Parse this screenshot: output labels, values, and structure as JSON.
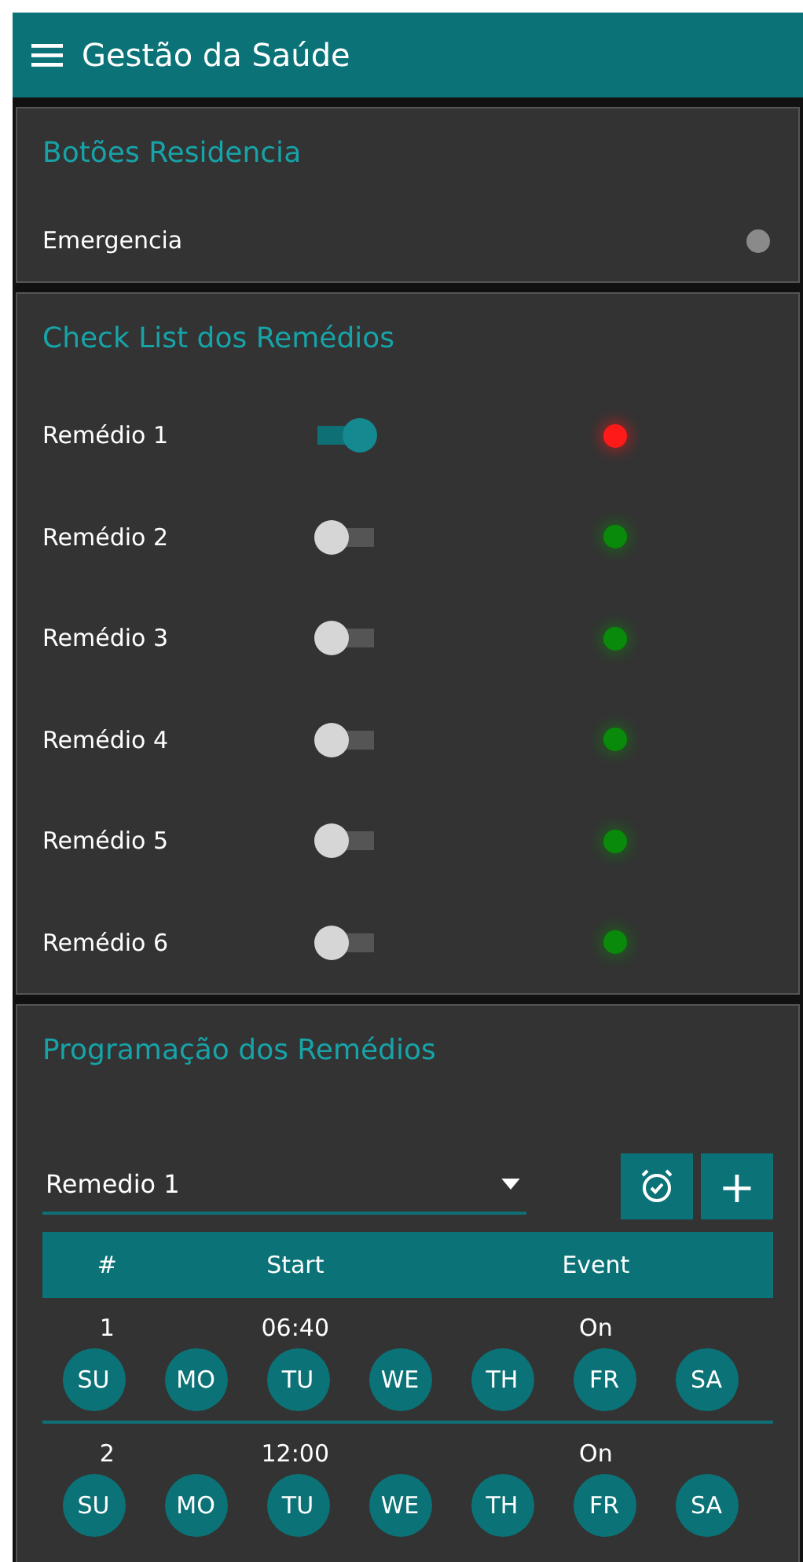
{
  "app_bar": {
    "title": "Gestão da Saúde"
  },
  "buttons_panel": {
    "title": "Botões Residencia",
    "items": [
      {
        "label": "Emergencia",
        "color": "#8a8a8a"
      }
    ]
  },
  "checklist": {
    "title": "Check List dos Remédios",
    "items": [
      {
        "label": "Remédio 1",
        "on": true,
        "color": "#ff1a1a"
      },
      {
        "label": "Remédio 2",
        "on": false,
        "color": "#0a8a0a"
      },
      {
        "label": "Remédio 3",
        "on": false,
        "color": "#0a8a0a"
      },
      {
        "label": "Remédio 4",
        "on": false,
        "color": "#0a8a0a"
      },
      {
        "label": "Remédio 5",
        "on": false,
        "color": "#0a8a0a"
      },
      {
        "label": "Remédio 6",
        "on": false,
        "color": "#0a8a0a"
      }
    ]
  },
  "schedule": {
    "title": "Programação dos Remédios",
    "select": {
      "value": "Remedio 1"
    },
    "add_button": "+",
    "table": {
      "columns": [
        "#",
        "Start",
        "Event"
      ],
      "rows": [
        {
          "number": "1",
          "start": "06:40",
          "event": "On",
          "days": [
            {
              "label": "SU",
              "selected": true
            },
            {
              "label": "MO",
              "selected": true
            },
            {
              "label": "TU",
              "selected": true
            },
            {
              "label": "WE",
              "selected": true
            },
            {
              "label": "TH",
              "selected": true
            },
            {
              "label": "FR",
              "selected": true
            },
            {
              "label": "SA",
              "selected": true
            }
          ]
        },
        {
          "number": "2",
          "start": "12:00",
          "event": "On",
          "days": [
            {
              "label": "SU",
              "selected": true
            },
            {
              "label": "MO",
              "selected": true
            },
            {
              "label": "TU",
              "selected": true
            },
            {
              "label": "WE",
              "selected": true
            },
            {
              "label": "TH",
              "selected": true
            },
            {
              "label": "FR",
              "selected": true
            },
            {
              "label": "SA",
              "selected": true
            }
          ]
        }
      ]
    }
  }
}
